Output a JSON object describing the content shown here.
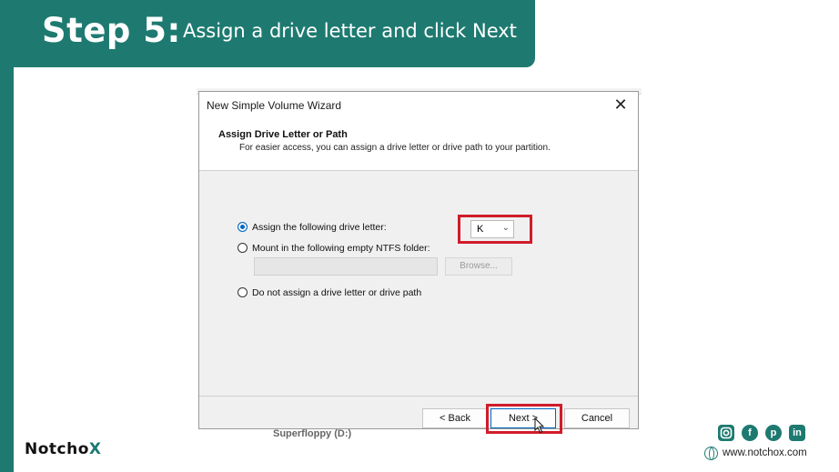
{
  "banner": {
    "step": "Step 5:",
    "instruction": "Assign a drive letter and click Next"
  },
  "dialog": {
    "title": "New Simple Volume Wizard",
    "close_glyph": "✕",
    "header_title": "Assign Drive Letter or Path",
    "header_subtitle": "For easier access, you can assign a drive letter or drive path to your partition.",
    "options": [
      {
        "label": "Assign the following drive letter:",
        "selected": true
      },
      {
        "label": "Mount in the following empty NTFS folder:",
        "selected": false
      },
      {
        "label": "Do not assign a drive letter or drive path",
        "selected": false
      }
    ],
    "drive_letter": "K",
    "folder_path": "",
    "browse_label": "Browse...",
    "back_label": "< Back",
    "next_label": "Next >",
    "cancel_label": "Cancel"
  },
  "background_text": "Superfloppy (D:)",
  "brand": {
    "logo_prefix": "Notch",
    "logo_o": "o",
    "logo_x": "X",
    "website": "www.notchox.com",
    "social_icons": [
      "instagram-icon",
      "facebook-icon",
      "pinterest-icon",
      "linkedin-icon"
    ]
  },
  "colors": {
    "brand_teal": "#1e7a70",
    "highlight_red": "#d01c2a",
    "accent_blue": "#0067c0"
  }
}
